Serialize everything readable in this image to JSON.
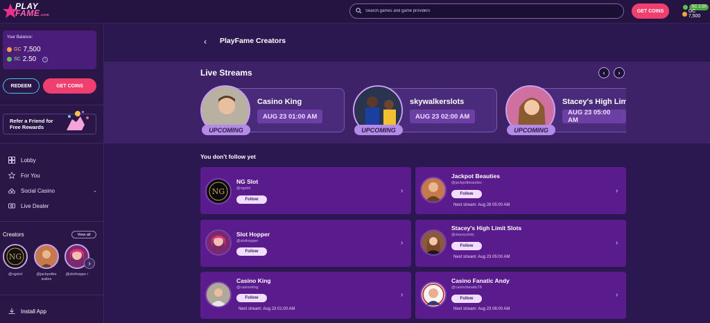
{
  "header": {
    "logo_line1": "PLAY",
    "logo_line2": "FAME",
    "logo_suffix": ".com",
    "search_placeholder": "Search games and game providers",
    "get_coins": "GET COINS",
    "sc_balance": "SC 2.50",
    "gc_balance": "GC 7,500"
  },
  "sidebar": {
    "balance_title": "Your Balance:",
    "gc_label": "GC",
    "gc_value": "7,500",
    "sc_label": "SC",
    "sc_value": "2.50",
    "redeem": "REDEEM",
    "get_coins": "GET COINS",
    "refer_text": "Refer a Friend for Free Rewards",
    "nav": [
      {
        "label": "Lobby",
        "icon": "lobby-icon"
      },
      {
        "label": "For You",
        "icon": "star-icon"
      },
      {
        "label": "Social Casino",
        "icon": "cherry-icon"
      },
      {
        "label": "Live Dealer",
        "icon": "cards-icon"
      }
    ],
    "creators_title": "Creators",
    "view_all": "View all",
    "creators": [
      {
        "handle": "@ngslot"
      },
      {
        "handle": "@jackpotbe auties"
      },
      {
        "handle": "@slothoppe r"
      }
    ],
    "install_app": "Install App"
  },
  "page": {
    "back": "‹",
    "title": "PlayFame Creators",
    "live_title": "Live Streams",
    "live_streams": [
      {
        "name": "Casino King",
        "date": "AUG 23 01:00 AM",
        "badge": "UPCOMING"
      },
      {
        "name": "skywalkerslots",
        "date": "AUG 23 02:00 AM",
        "badge": "UPCOMING"
      },
      {
        "name": "Stacey's High Limit Slots",
        "date": "AUG 23 05:00 AM",
        "badge": "UPCOMING"
      }
    ],
    "follow_title": "You don't follow yet",
    "follow_label": "Follow",
    "next_stream_label": "Next stream:",
    "creators": [
      {
        "name": "NG Slot",
        "handle": "@ngslot",
        "next": ""
      },
      {
        "name": "Jackpot Beauties",
        "handle": "@jackpotbeauties",
        "next": "Aug 28 05:00 AM"
      },
      {
        "name": "Slot Hopper",
        "handle": "@slothopper",
        "next": ""
      },
      {
        "name": "Stacey's High Limit Slots",
        "handle": "@staceyslots",
        "next": "Aug 23 05:00 AM"
      },
      {
        "name": "Casino King",
        "handle": "@casinoking",
        "next": "Aug 23 01:00 AM"
      },
      {
        "name": "Casino Fanatic Andy",
        "handle": "@casinofanatic78",
        "next": "Aug 23 06:00 AM"
      }
    ]
  }
}
